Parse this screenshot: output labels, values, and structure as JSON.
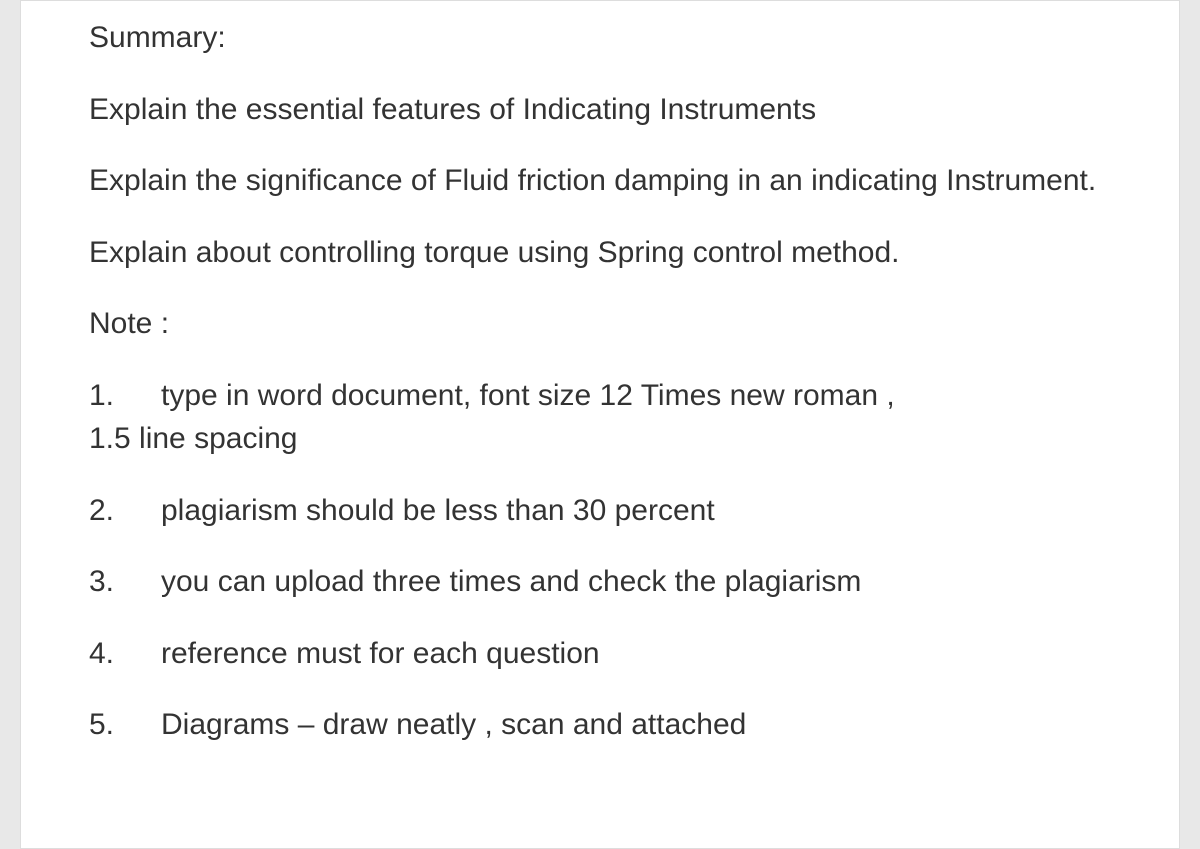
{
  "summary_label": "Summary:",
  "paragraphs": [
    "Explain the essential features of Indicating Instruments",
    "Explain the significance of Fluid friction damping in an indicating Instrument.",
    "Explain about controlling torque using Spring control method."
  ],
  "note_label": "Note :",
  "notes": [
    {
      "num": "1.",
      "text": "type in word document, font size 12 Times new roman , ",
      "cont": "1.5 line spacing"
    },
    {
      "num": "2.",
      "text": "plagiarism should be less than 30 percent"
    },
    {
      "num": "3.",
      "text": "you can upload three times and check the plagiarism"
    },
    {
      "num": "4.",
      "text": "reference must for each question"
    },
    {
      "num": "5.",
      "text": "Diagrams – draw neatly , scan and attached"
    }
  ]
}
